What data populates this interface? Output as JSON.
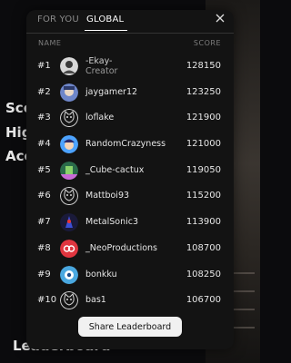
{
  "background": {
    "side_text": [
      "Sco",
      "Hig",
      "Acc"
    ],
    "bottom_text": "Leaderboard"
  },
  "leaderboard": {
    "tabs": [
      {
        "label": "FOR YOU",
        "active": false
      },
      {
        "label": "GLOBAL",
        "active": true
      }
    ],
    "close_icon": "close-icon",
    "columns": {
      "name": "NAME",
      "score": "SCORE"
    },
    "rows": [
      {
        "rank": "#1",
        "name": "-Ekay-",
        "subtitle": "Creator",
        "score": "128150",
        "avatar": "photo-avatar"
      },
      {
        "rank": "#2",
        "name": "jaygamer12",
        "score": "123250",
        "avatar": "photo-avatar"
      },
      {
        "rank": "#3",
        "name": "loflake",
        "score": "121900",
        "avatar": "default-cat-avatar"
      },
      {
        "rank": "#4",
        "name": "RandomCrazyness",
        "score": "121000",
        "avatar": "photo-avatar"
      },
      {
        "rank": "#5",
        "name": "_Cube-cactux",
        "score": "119050",
        "avatar": "photo-avatar"
      },
      {
        "rank": "#6",
        "name": "Mattboi93",
        "score": "115200",
        "avatar": "default-cat-avatar"
      },
      {
        "rank": "#7",
        "name": "MetalSonic3",
        "score": "113900",
        "avatar": "photo-avatar"
      },
      {
        "rank": "#8",
        "name": "_NeoProductions",
        "score": "108700",
        "avatar": "red-logo-avatar"
      },
      {
        "rank": "#9",
        "name": "bonkku",
        "score": "108250",
        "avatar": "photo-avatar"
      },
      {
        "rank": "#10",
        "name": "bas1",
        "score": "106700",
        "avatar": "default-cat-avatar"
      }
    ],
    "share_label": "Share Leaderboard"
  }
}
